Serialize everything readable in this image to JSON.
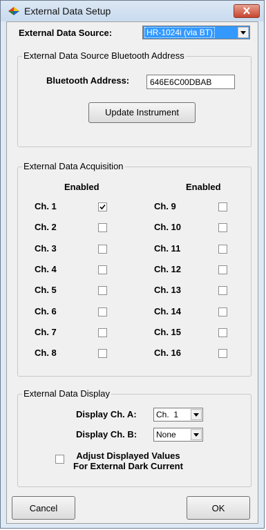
{
  "window": {
    "title": "External Data Setup",
    "icon": "colorful-diamond-icon"
  },
  "source": {
    "label": "External Data Source:",
    "value": "HR-1024i (via BT)"
  },
  "bluetooth": {
    "group_title": "External Data Source Bluetooth Address",
    "address_label": "Bluetooth Address:",
    "address_value": "646E6C00DBAB",
    "update_button": "Update Instrument"
  },
  "acquisition": {
    "group_title": "External Data Acquisition",
    "enabled_header": "Enabled",
    "channels": [
      {
        "label": "Ch. 1",
        "checked": true
      },
      {
        "label": "Ch. 2",
        "checked": false
      },
      {
        "label": "Ch. 3",
        "checked": false
      },
      {
        "label": "Ch. 4",
        "checked": false
      },
      {
        "label": "Ch. 5",
        "checked": false
      },
      {
        "label": "Ch. 6",
        "checked": false
      },
      {
        "label": "Ch. 7",
        "checked": false
      },
      {
        "label": "Ch. 8",
        "checked": false
      },
      {
        "label": "Ch. 9",
        "checked": false
      },
      {
        "label": "Ch. 10",
        "checked": false
      },
      {
        "label": "Ch. 11",
        "checked": false
      },
      {
        "label": "Ch. 12",
        "checked": false
      },
      {
        "label": "Ch. 13",
        "checked": false
      },
      {
        "label": "Ch. 14",
        "checked": false
      },
      {
        "label": "Ch. 15",
        "checked": false
      },
      {
        "label": "Ch. 16",
        "checked": false
      }
    ]
  },
  "display": {
    "group_title": "External Data Display",
    "ch_a_label": "Display Ch. A:",
    "ch_a_value": "Ch.  1",
    "ch_b_label": "Display Ch. B:",
    "ch_b_value": "None",
    "adjust_line1": "Adjust Displayed Values",
    "adjust_line2": "For External Dark Current",
    "adjust_checked": false
  },
  "buttons": {
    "cancel": "Cancel",
    "ok": "OK"
  },
  "colors": {
    "selection": "#3399ff",
    "close": "#c7452f",
    "titlebar": "#c9dbef"
  }
}
